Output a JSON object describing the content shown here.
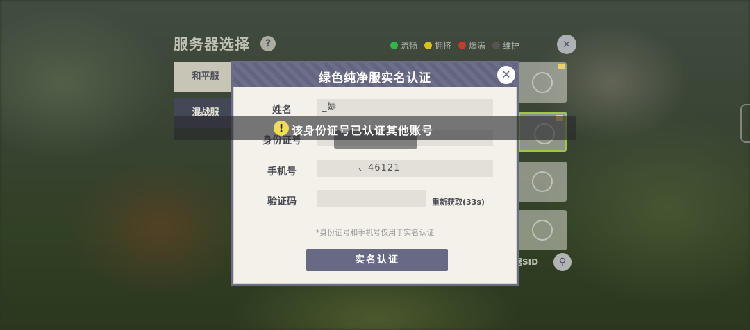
{
  "background_panel": {
    "title": "服务器选择",
    "help_icon": "?",
    "legend": [
      {
        "label": "流畅",
        "color": "#2db84a"
      },
      {
        "label": "拥挤",
        "color": "#d9c21c"
      },
      {
        "label": "爆满",
        "color": "#c83a2e"
      },
      {
        "label": "维护",
        "color": "#555555"
      }
    ],
    "tabs": [
      "和平服",
      "混战服"
    ],
    "sid_label": "器SID"
  },
  "modal": {
    "title": "绿色纯净服实名认证",
    "fields": {
      "name_label": "姓名",
      "name_value": "_婕",
      "id_label": "身份证号",
      "id_value": "",
      "phone_label": "手机号",
      "phone_value": "、46121",
      "code_label": "验证码",
      "code_value": ""
    },
    "resend_label": "重新获取(33s)",
    "note": "*身份证号和手机号仅用于实名认证",
    "submit_label": "实名认证"
  },
  "toast": {
    "icon": "!",
    "message": "该身份证号已认证其他账号"
  },
  "colors": {
    "modal_header": "#676884",
    "modal_bg": "#f3f1e9",
    "toast_icon": "#f0de4c"
  }
}
